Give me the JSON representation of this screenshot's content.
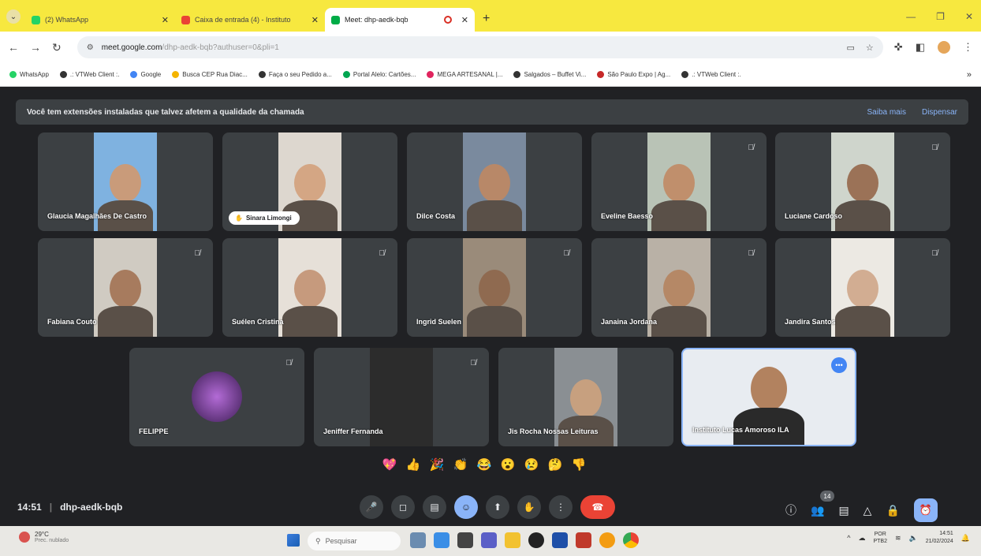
{
  "browser": {
    "tabs": [
      {
        "title": "(2) WhatsApp",
        "color": "#25d366"
      },
      {
        "title": "Caixa de entrada (4) - Instituto",
        "color": "#ea4335"
      },
      {
        "title": "Meet: dhp-aedk-bqb",
        "color": "#00ac47"
      }
    ],
    "new_tab": "+",
    "url_main": "meet.google.com",
    "url_rest": "/dhp-aedk-bqb?authuser=0&pli=1"
  },
  "bookmarks": [
    {
      "label": "WhatsApp",
      "color": "#25d366"
    },
    {
      "label": ".: VTWeb Client :.",
      "color": "#333333"
    },
    {
      "label": "Google",
      "color": "#4285f4"
    },
    {
      "label": "Busca CEP Rua Diac...",
      "color": "#f4b400"
    },
    {
      "label": "Faça o seu Pedido a...",
      "color": "#333333"
    },
    {
      "label": "Portal Alelo: Cartões...",
      "color": "#00a651"
    },
    {
      "label": "MEGA ARTESANAL |...",
      "color": "#e0245e"
    },
    {
      "label": "Salgados – Buffet Vi...",
      "color": "#333333"
    },
    {
      "label": "São Paulo Expo | Ag...",
      "color": "#c62828"
    },
    {
      "label": ".: VTWeb Client :.",
      "color": "#333333"
    }
  ],
  "meet": {
    "banner_text": "Você tem extensões instaladas que talvez afetem a qualidade da chamada",
    "learn_more": "Saiba mais",
    "dismiss": "Dispensar",
    "participants": [
      {
        "name": "Glaucia Magalhães De Castro"
      },
      {
        "name": "Sinara Limongi"
      },
      {
        "name": "Dilce Costa"
      },
      {
        "name": "Eveline Baesso"
      },
      {
        "name": "Luciane Cardoso"
      },
      {
        "name": "Fabiana Couto"
      },
      {
        "name": "Suélen Cristina"
      },
      {
        "name": "Ingrid Suelen"
      },
      {
        "name": "Janaina Jordana"
      },
      {
        "name": "Jandira Santos"
      },
      {
        "name": "FELIPPE"
      },
      {
        "name": "Jeniffer Fernanda"
      },
      {
        "name": "Jis Rocha Nossas Leituras"
      },
      {
        "name": "Instituto Lucas Amoroso ILA"
      }
    ],
    "time": "14:51",
    "meeting_code": "dhp-aedk-bqb",
    "people_count": "14",
    "reactions": [
      "💖",
      "👍",
      "🎉",
      "👏",
      "😂",
      "😮",
      "😢",
      "🤔",
      "👎"
    ]
  },
  "taskbar": {
    "temp": "29°C",
    "weather": "Prec. nublado",
    "search": "Pesquisar",
    "lang1": "POR",
    "lang2": "PTB2",
    "time": "14:51",
    "date": "21/02/2024"
  }
}
